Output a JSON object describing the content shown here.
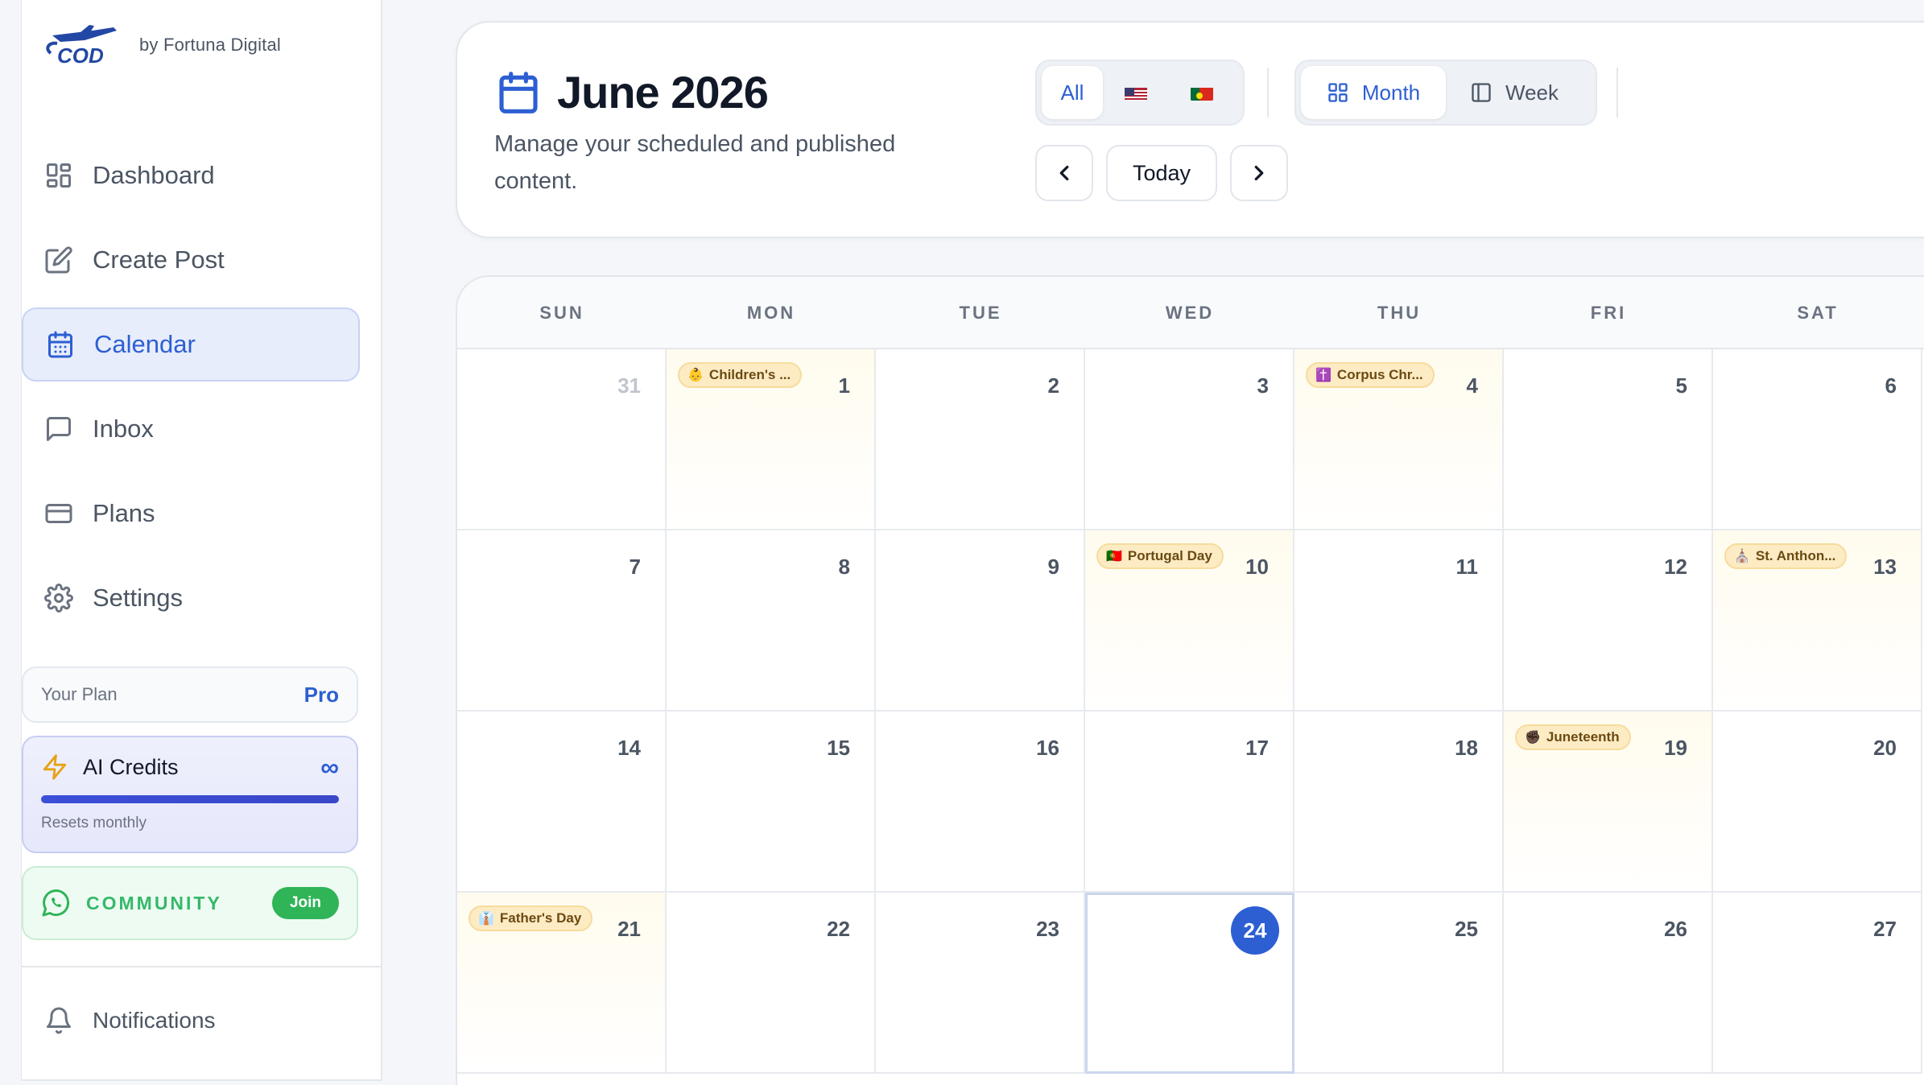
{
  "brand": {
    "logo_text": "COD",
    "byline": "by Fortuna Digital"
  },
  "sidebar": {
    "items": [
      {
        "label": "Dashboard",
        "icon": "grid-icon",
        "active": false
      },
      {
        "label": "Create Post",
        "icon": "edit-icon",
        "active": false
      },
      {
        "label": "Calendar",
        "icon": "calendar-icon",
        "active": true
      },
      {
        "label": "Inbox",
        "icon": "message-icon",
        "active": false
      },
      {
        "label": "Plans",
        "icon": "credit-card-icon",
        "active": false
      },
      {
        "label": "Settings",
        "icon": "gear-icon",
        "active": false
      }
    ],
    "plan": {
      "label": "Your Plan",
      "value": "Pro"
    },
    "credits": {
      "title": "AI Credits",
      "value": "∞",
      "subtitle": "Resets monthly",
      "fill": 1.0
    },
    "community": {
      "label": "COMMUNITY",
      "button": "Join"
    },
    "notifications": "Notifications"
  },
  "header": {
    "title": "June 2026",
    "subtitle": "Manage your scheduled and published content.",
    "filters": [
      {
        "label": "All",
        "active": true
      },
      {
        "label": "",
        "icon": "us-flag-icon",
        "active": false
      },
      {
        "label": "",
        "icon": "portugal-flag-icon",
        "active": false
      }
    ],
    "views": [
      {
        "label": "Month",
        "icon": "grid-icon",
        "active": true
      },
      {
        "label": "Week",
        "icon": "columns-icon",
        "active": false
      }
    ],
    "today_label": "Today"
  },
  "calendar": {
    "weekdays": [
      "SUN",
      "MON",
      "TUE",
      "WED",
      "THU",
      "FRI",
      "SAT"
    ],
    "weeks": [
      [
        {
          "day": "31",
          "muted": true
        },
        {
          "day": "1",
          "event": "Children's ...",
          "emoji": "👶"
        },
        {
          "day": "2"
        },
        {
          "day": "3"
        },
        {
          "day": "4",
          "event": "Corpus Chr...",
          "emoji": "✝️"
        },
        {
          "day": "5"
        },
        {
          "day": "6"
        }
      ],
      [
        {
          "day": "7"
        },
        {
          "day": "8"
        },
        {
          "day": "9"
        },
        {
          "day": "10",
          "event": "Portugal Day",
          "emoji": "🇵🇹"
        },
        {
          "day": "11"
        },
        {
          "day": "12"
        },
        {
          "day": "13",
          "event": "St. Anthon...",
          "emoji": "⛪"
        }
      ],
      [
        {
          "day": "14"
        },
        {
          "day": "15"
        },
        {
          "day": "16"
        },
        {
          "day": "17"
        },
        {
          "day": "18"
        },
        {
          "day": "19",
          "event": "Juneteenth",
          "emoji": "✊🏿"
        },
        {
          "day": "20"
        }
      ],
      [
        {
          "day": "21",
          "event": "Father's Day",
          "emoji": "👔"
        },
        {
          "day": "22"
        },
        {
          "day": "23"
        },
        {
          "day": "24",
          "today": true
        },
        {
          "day": "25"
        },
        {
          "day": "26"
        },
        {
          "day": "27"
        }
      ]
    ]
  },
  "colors": {
    "accent": "#2d5fd3",
    "holiday_pill": "#fdebc4",
    "community_green": "#2fb457"
  }
}
